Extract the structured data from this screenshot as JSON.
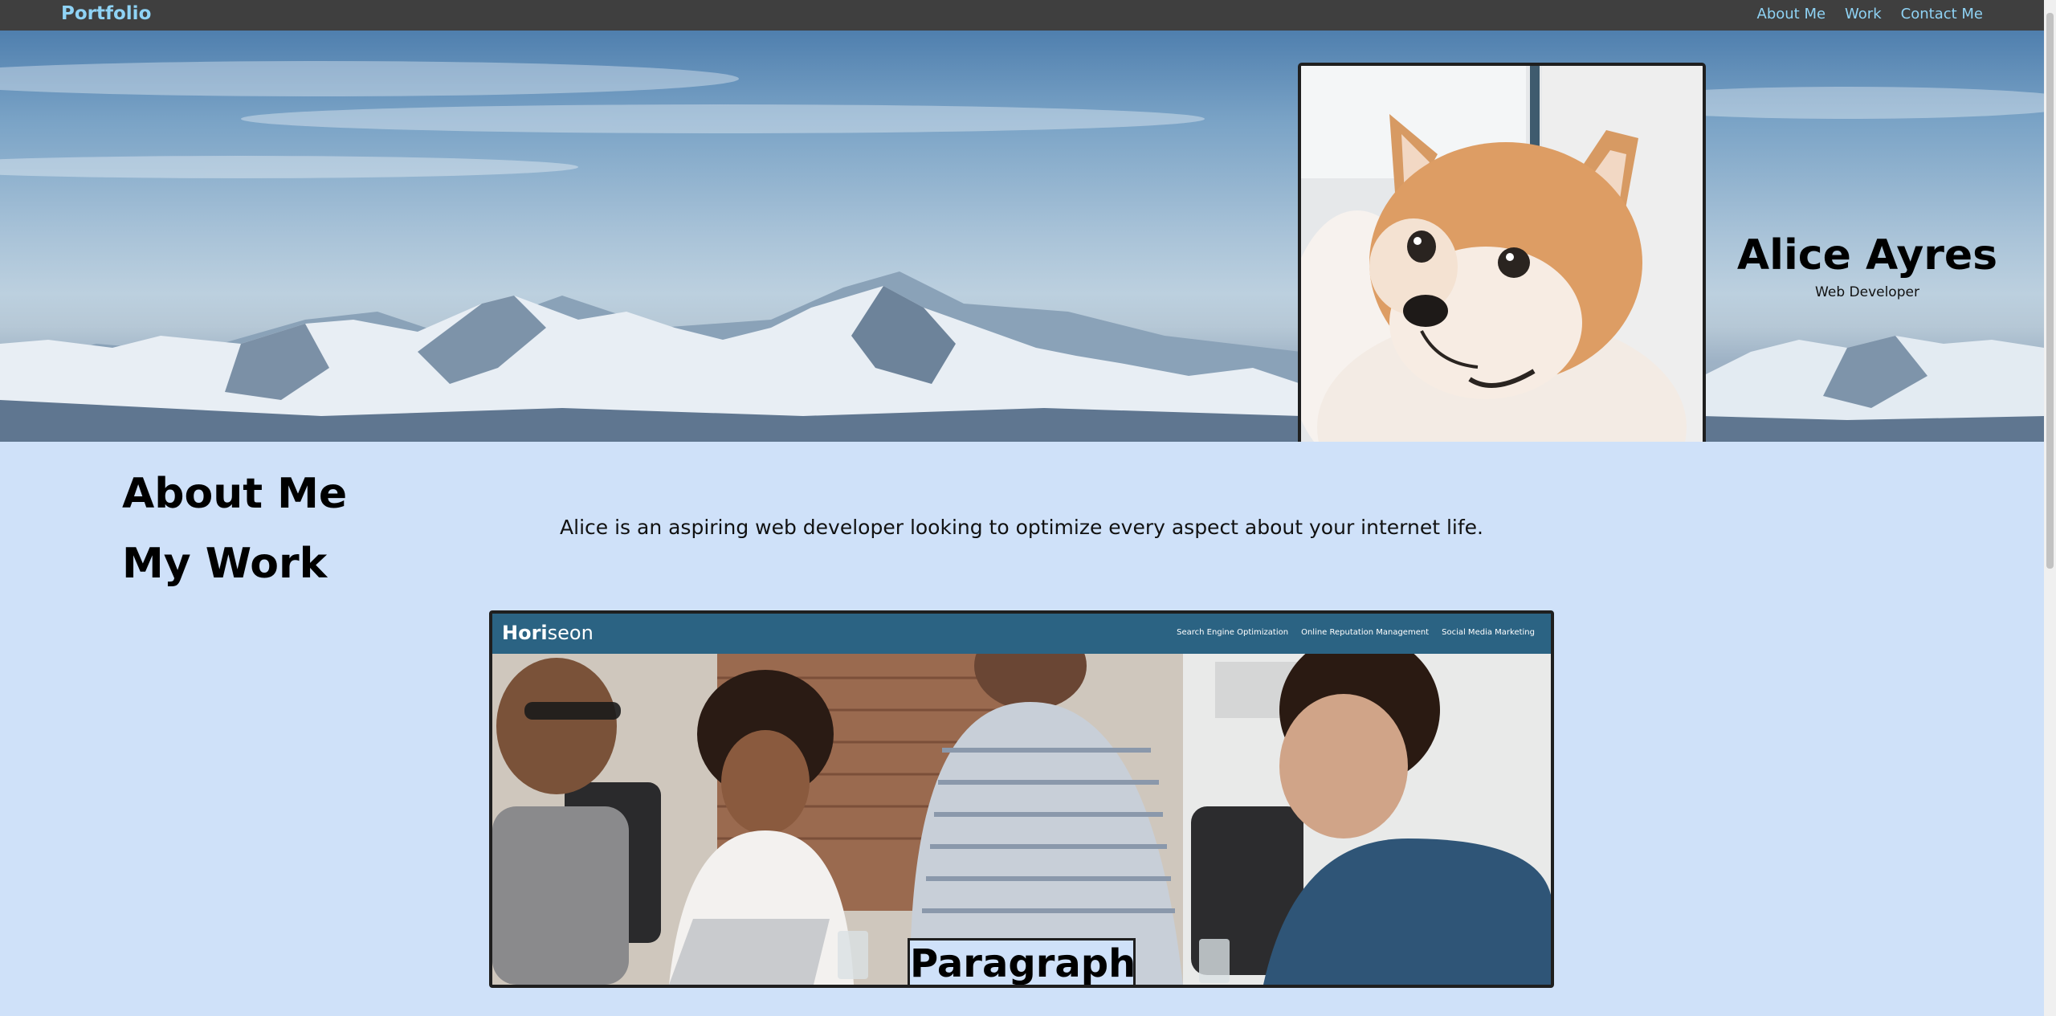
{
  "nav": {
    "brand": "Portfolio",
    "links": [
      "About Me",
      "Work",
      "Contact Me"
    ]
  },
  "hero": {
    "name": "Alice Ayres",
    "role": "Web Developer"
  },
  "about": {
    "heading": "About Me",
    "text": "Alice is an aspiring web developer looking to optimize every aspect about your internet life."
  },
  "work": {
    "heading": "My Work",
    "project": {
      "logo_bold": "Hori",
      "logo_rest": "seon",
      "nav": [
        "Search Engine Optimization",
        "Online Reputation Management",
        "Social Media Marketing"
      ],
      "caption": "Paragraph"
    }
  },
  "colors": {
    "nav_bg": "#3f3f3f",
    "nav_link": "#8fd3f5",
    "page_bg": "#cfe1f9",
    "project_header": "#2b6383"
  }
}
